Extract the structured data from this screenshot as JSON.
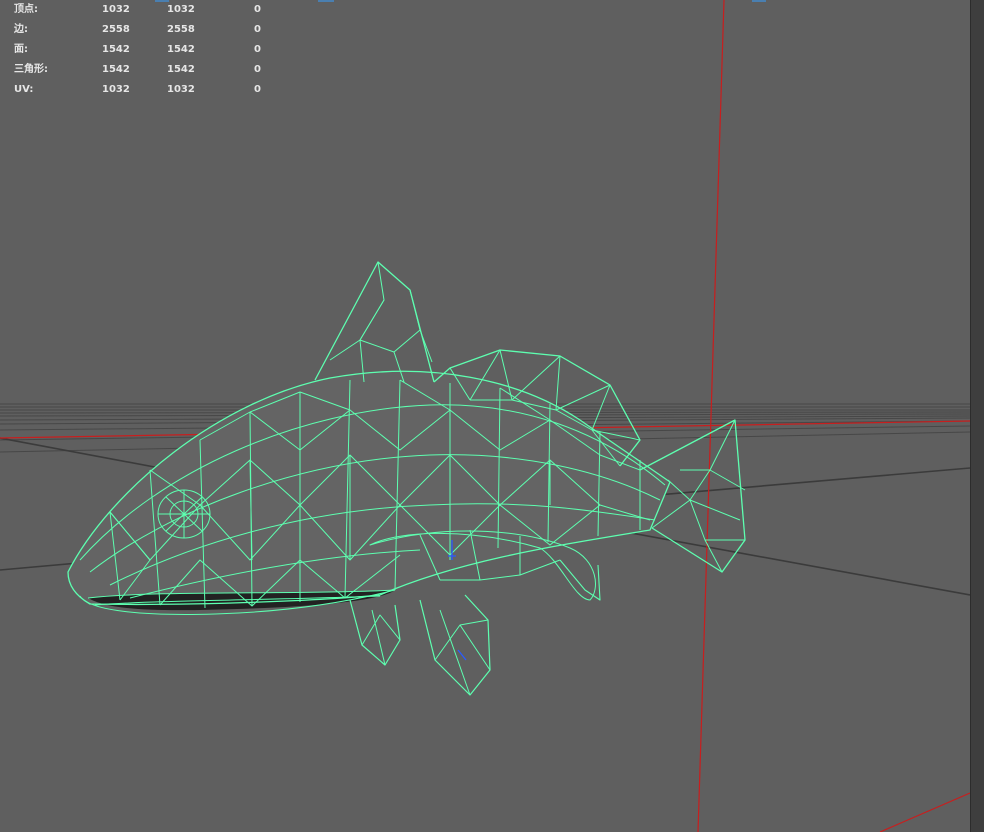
{
  "hud": {
    "rows": [
      {
        "label": "顶点:",
        "v1": "1032",
        "v2": "1032",
        "v3": "0"
      },
      {
        "label": "边:",
        "v1": "2558",
        "v2": "2558",
        "v3": "0"
      },
      {
        "label": "面:",
        "v1": "1542",
        "v2": "1542",
        "v3": "0"
      },
      {
        "label": "三角形:",
        "v1": "1542",
        "v2": "1542",
        "v3": "0"
      },
      {
        "label": "UV:",
        "v1": "1032",
        "v2": "1032",
        "v3": "0"
      }
    ]
  },
  "colors": {
    "viewport_bg": "#5f5f5f",
    "wire": "#5dffb0",
    "axis_red": "#c81e1e",
    "grid": "#3c3c3c",
    "hud_text": "#e6e6e6"
  }
}
